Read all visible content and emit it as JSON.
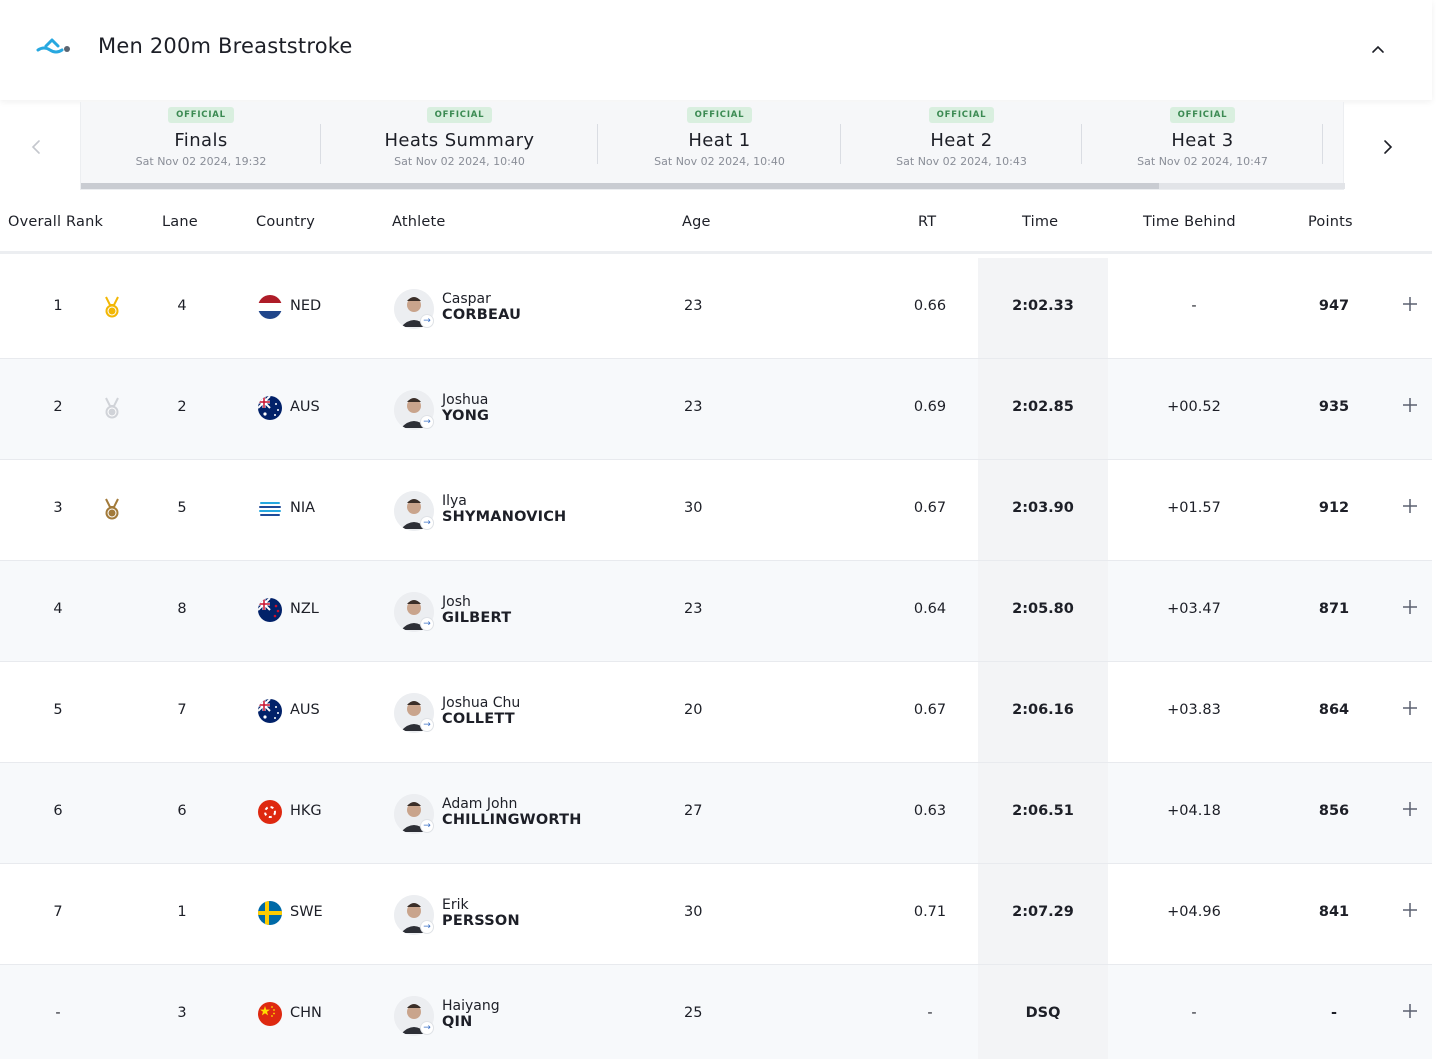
{
  "event": {
    "title": "Men 200m Breaststroke",
    "icon": "swimmer-icon"
  },
  "tabs": [
    {
      "status": "OFFICIAL",
      "name": "Finals",
      "date": "Sat Nov 02 2024, 19:32",
      "active": true
    },
    {
      "status": "OFFICIAL",
      "name": "Heats Summary",
      "date": "Sat Nov 02 2024, 10:40"
    },
    {
      "status": "OFFICIAL",
      "name": "Heat 1",
      "date": "Sat Nov 02 2024, 10:40"
    },
    {
      "status": "OFFICIAL",
      "name": "Heat 2",
      "date": "Sat Nov 02 2024, 10:43"
    },
    {
      "status": "OFFICIAL",
      "name": "Heat 3",
      "date": "Sat Nov 02 2024, 10:47"
    }
  ],
  "columns": {
    "rank": "Overall Rank",
    "lane": "Lane",
    "country": "Country",
    "athlete": "Athlete",
    "age": "Age",
    "rt": "RT",
    "time": "Time",
    "behind": "Time Behind",
    "points": "Points"
  },
  "rows": [
    {
      "rank": "1",
      "medal": "gold",
      "lane": "4",
      "country": "NED",
      "first": "Caspar",
      "last": "CORBEAU",
      "age": "23",
      "rt": "0.66",
      "time": "2:02.33",
      "behind": "-",
      "points": "947"
    },
    {
      "rank": "2",
      "medal": "silver",
      "lane": "2",
      "country": "AUS",
      "first": "Joshua",
      "last": "YONG",
      "age": "23",
      "rt": "0.69",
      "time": "2:02.85",
      "behind": "+00.52",
      "points": "935"
    },
    {
      "rank": "3",
      "medal": "bronze",
      "lane": "5",
      "country": "NIA",
      "first": "Ilya",
      "last": "SHYMANOVICH",
      "age": "30",
      "rt": "0.67",
      "time": "2:03.90",
      "behind": "+01.57",
      "points": "912"
    },
    {
      "rank": "4",
      "medal": "",
      "lane": "8",
      "country": "NZL",
      "first": "Josh",
      "last": "GILBERT",
      "age": "23",
      "rt": "0.64",
      "time": "2:05.80",
      "behind": "+03.47",
      "points": "871"
    },
    {
      "rank": "5",
      "medal": "",
      "lane": "7",
      "country": "AUS",
      "first": "Joshua Chu",
      "last": "COLLETT",
      "age": "20",
      "rt": "0.67",
      "time": "2:06.16",
      "behind": "+03.83",
      "points": "864"
    },
    {
      "rank": "6",
      "medal": "",
      "lane": "6",
      "country": "HKG",
      "first": "Adam John",
      "last": "CHILLINGWORTH",
      "age": "27",
      "rt": "0.63",
      "time": "2:06.51",
      "behind": "+04.18",
      "points": "856"
    },
    {
      "rank": "7",
      "medal": "",
      "lane": "1",
      "country": "SWE",
      "first": "Erik",
      "last": "PERSSON",
      "age": "30",
      "rt": "0.71",
      "time": "2:07.29",
      "behind": "+04.96",
      "points": "841"
    },
    {
      "rank": "-",
      "medal": "",
      "lane": "3",
      "country": "CHN",
      "first": "Haiyang",
      "last": "QIN",
      "age": "25",
      "rt": "-",
      "time": "DSQ",
      "behind": "-",
      "points": "-"
    }
  ],
  "colors": {
    "accent": "#1f4b98",
    "official_bg": "#d9efdf",
    "official_text": "#3b8a52",
    "logo": "#27a8e0"
  }
}
